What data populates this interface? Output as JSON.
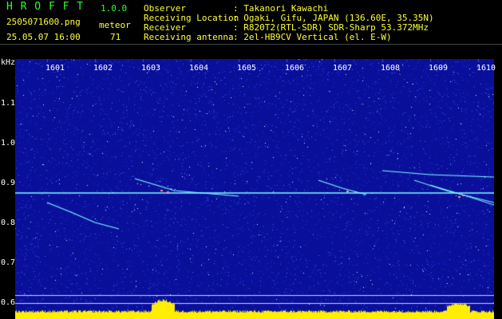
{
  "app": {
    "name": "H R O F F T",
    "version": "1.0.0",
    "filename": "2505071600.png",
    "datetime": "25.05.07 16:00",
    "count_label": "meteor",
    "count_value": "71"
  },
  "info": {
    "observer_label": "Observer",
    "observer_value": ": Takanori Kawachi",
    "location_label": "Receiving Location",
    "location_value": ": Ogaki, Gifu, JAPAN (136.60E, 35.35N)",
    "receiver_label": "Receiver",
    "receiver_value": ": R820T2(RTL-SDR) SDR-Sharp 53.372MHz",
    "antenna_label": "Receiving antenna",
    "antenna_value": ": 2el-HB9CV Vertical (el. E-W)"
  },
  "axis": {
    "y_unit": "kHz",
    "x_ticks": [
      "1601",
      "1602",
      "1603",
      "1604",
      "1605",
      "1606",
      "1607",
      "1608",
      "1609",
      "1610"
    ],
    "y_ticks": [
      "1.1",
      "1.0",
      "0.9",
      "0.8",
      "0.7",
      "0.6"
    ]
  },
  "colors": {
    "background": "#0a0f9a",
    "header_green": "#2bff2b",
    "header_yellow": "#ffff33",
    "trace_cyan": "#7fffff",
    "baseline_yellow": "#ffee00"
  }
}
